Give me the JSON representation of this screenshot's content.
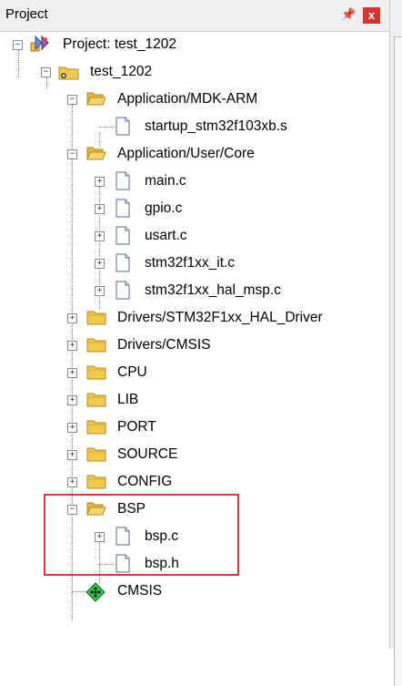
{
  "panel": {
    "title": "Project",
    "pin_icon": "pin-icon",
    "close_label": "x"
  },
  "tree": [
    {
      "label": "Project: test_1202",
      "icon": "project-icon",
      "expander": "−",
      "level": 0
    },
    {
      "label": "test_1202",
      "icon": "target-folder-icon",
      "expander": "−",
      "level": 1
    },
    {
      "label": "Application/MDK-ARM",
      "icon": "folder-open-icon",
      "expander": "−",
      "level": 2
    },
    {
      "label": "startup_stm32f103xb.s",
      "icon": "file-icon",
      "expander": "",
      "level": 3
    },
    {
      "label": "Application/User/Core",
      "icon": "folder-open-icon",
      "expander": "−",
      "level": 2
    },
    {
      "label": "main.c",
      "icon": "file-icon",
      "expander": "+",
      "level": 3
    },
    {
      "label": "gpio.c",
      "icon": "file-icon",
      "expander": "+",
      "level": 3
    },
    {
      "label": "usart.c",
      "icon": "file-icon",
      "expander": "+",
      "level": 3
    },
    {
      "label": "stm32f1xx_it.c",
      "icon": "file-icon",
      "expander": "+",
      "level": 3
    },
    {
      "label": "stm32f1xx_hal_msp.c",
      "icon": "file-icon",
      "expander": "+",
      "level": 3
    },
    {
      "label": "Drivers/STM32F1xx_HAL_Driver",
      "icon": "folder-icon",
      "expander": "+",
      "level": 2
    },
    {
      "label": "Drivers/CMSIS",
      "icon": "folder-icon",
      "expander": "+",
      "level": 2
    },
    {
      "label": "CPU",
      "icon": "folder-icon",
      "expander": "+",
      "level": 2
    },
    {
      "label": "LIB",
      "icon": "folder-icon",
      "expander": "+",
      "level": 2
    },
    {
      "label": "PORT",
      "icon": "folder-icon",
      "expander": "+",
      "level": 2
    },
    {
      "label": "SOURCE",
      "icon": "folder-icon",
      "expander": "+",
      "level": 2
    },
    {
      "label": "CONFIG",
      "icon": "folder-icon",
      "expander": "+",
      "level": 2
    },
    {
      "label": "BSP",
      "icon": "folder-open-icon",
      "expander": "−",
      "level": 2
    },
    {
      "label": "bsp.c",
      "icon": "file-icon",
      "expander": "+",
      "level": 3
    },
    {
      "label": "bsp.h",
      "icon": "file-icon",
      "expander": "",
      "level": 3
    },
    {
      "label": "CMSIS",
      "icon": "cmsis-component-icon",
      "expander": "",
      "level": 2
    }
  ],
  "colors": {
    "highlight_border": "#e0323c",
    "close_bg": "#d9332f",
    "folder": "#f2c94c"
  }
}
